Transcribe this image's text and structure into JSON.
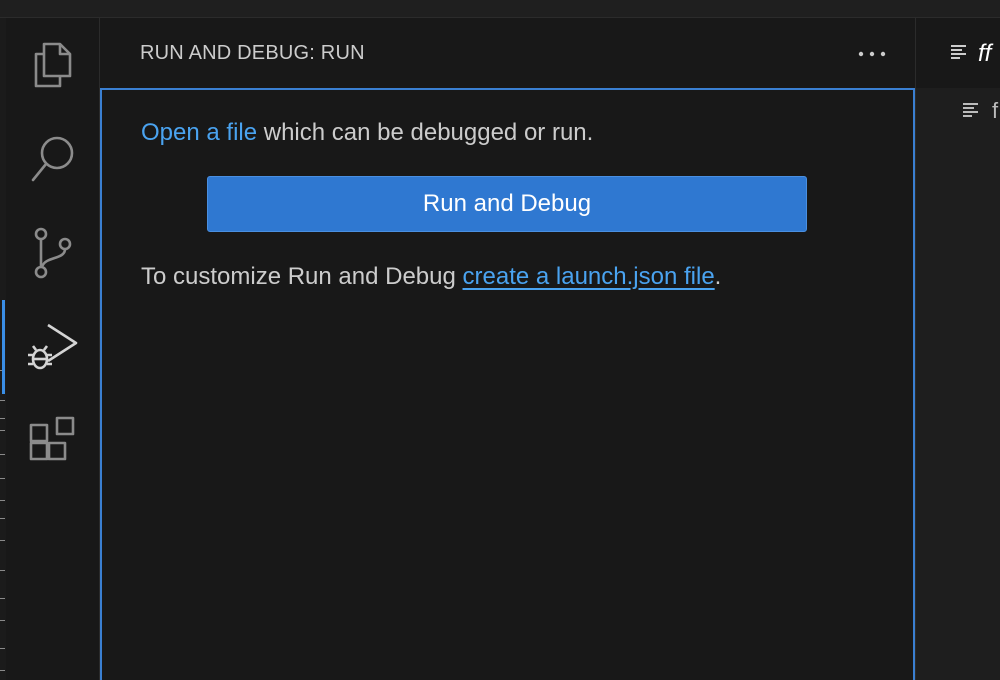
{
  "activity_bar": {
    "items": [
      {
        "name": "explorer",
        "icon": "files-icon"
      },
      {
        "name": "search",
        "icon": "search-icon"
      },
      {
        "name": "source-control",
        "icon": "source-control-icon"
      },
      {
        "name": "run-and-debug",
        "icon": "run-debug-icon",
        "active": true
      },
      {
        "name": "extensions",
        "icon": "extensions-icon"
      }
    ]
  },
  "sidebar": {
    "title": "RUN AND DEBUG: RUN",
    "more_actions_icon": "ellipsis-icon",
    "welcome": {
      "open_file_link": "Open a file",
      "open_file_rest": " which can be debugged or run.",
      "run_button_label": "Run and Debug",
      "customize_prefix": "To customize Run and Debug ",
      "launch_link": "create a launch.json file",
      "customize_suffix": "."
    }
  },
  "editor": {
    "tab_label": "ff",
    "outline_label": "f"
  },
  "colors": {
    "background": "#181818",
    "accent": "#3a7fd1",
    "button": "#2f78d1",
    "link": "#4aa3f0",
    "text": "#cccccc"
  }
}
